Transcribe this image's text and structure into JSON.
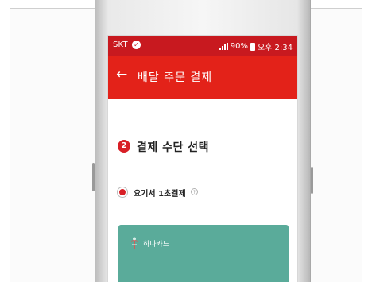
{
  "status_bar": {
    "carrier": "SKT",
    "battery": "90%",
    "time": "오후 2:34"
  },
  "app_bar": {
    "title": "배달 주문 결제"
  },
  "payment_section": {
    "step_number": "2",
    "title": "결제 수단 선택",
    "selected_method": "요기서 1초결제",
    "help_glyph": "?",
    "card_name": "하나카드"
  },
  "colors": {
    "status_bar": "#c8191f",
    "app_bar": "#e32219",
    "accent": "#d81f26",
    "card": "#5aab9a"
  },
  "icons": [
    "carrier-icon",
    "signal-icon",
    "battery-icon",
    "back-arrow-icon",
    "help-icon",
    "hana-card-logo-icon"
  ]
}
